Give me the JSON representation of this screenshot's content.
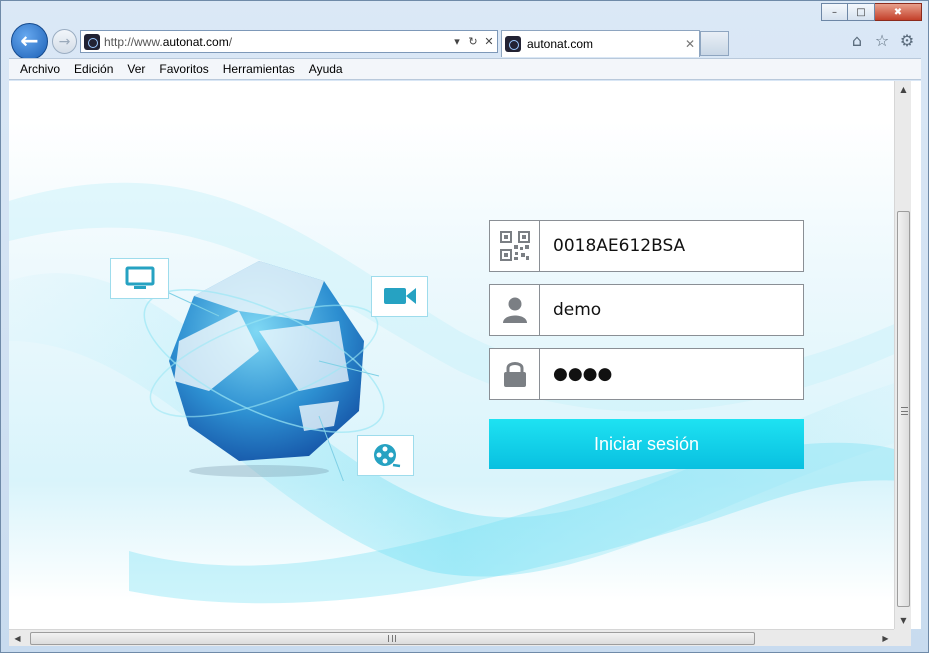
{
  "window": {
    "minimize_glyph": "–",
    "restore_glyph": "□",
    "close_glyph": "✖"
  },
  "nav": {
    "back_icon": "arrow-left-icon",
    "forward_icon": "arrow-right-icon",
    "back_glyph": "←",
    "forward_glyph": "→"
  },
  "address": {
    "url_prefix": "http://www.",
    "url_domain": "autonat.com",
    "url_suffix": "/",
    "dropdown_glyph": "▾",
    "refresh_glyph": "↻",
    "stop_glyph": "✕"
  },
  "tabs": [
    {
      "title": "autonat.com",
      "close_glyph": "✕"
    }
  ],
  "toolbar_icons": {
    "home": "⌂",
    "favorites": "☆",
    "settings": "⚙"
  },
  "menu": [
    "Archivo",
    "Edición",
    "Ver",
    "Favoritos",
    "Herramientas",
    "Ayuda"
  ],
  "login": {
    "device_id": "0018AE612BSA",
    "username": "demo",
    "password_mask": "●●●●",
    "submit_label": "Iniciar sesión"
  },
  "colors": {
    "accent": "#13d4ec",
    "globe_dark": "#1d6ab4",
    "globe_light": "#3fbbe3",
    "icon_teal": "#26a2c2"
  },
  "scroll": {
    "up_glyph": "▲",
    "down_glyph": "▼",
    "left_glyph": "◀",
    "right_glyph": "▶"
  }
}
